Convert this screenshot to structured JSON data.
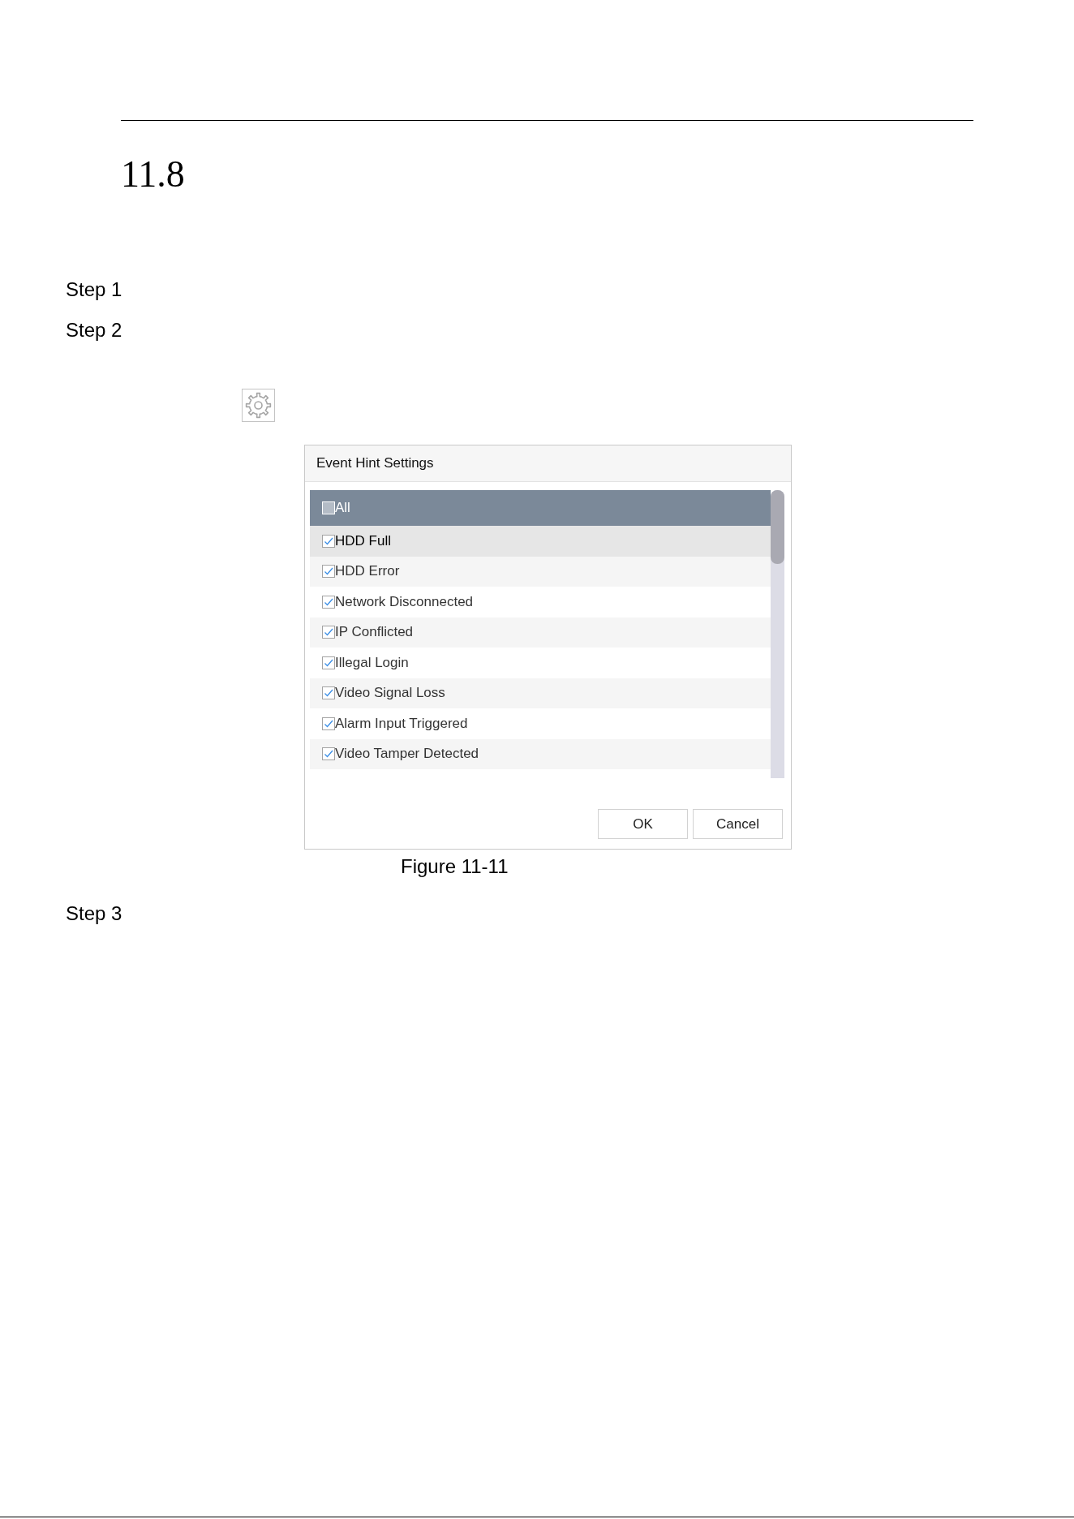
{
  "section_number": "11.8",
  "steps_before": [
    {
      "label": "Step 1"
    },
    {
      "label": "Step 2"
    }
  ],
  "dialog": {
    "title": "Event Hint Settings",
    "select_all": {
      "label": "All",
      "checked": false
    },
    "items": [
      {
        "label": "HDD Full",
        "checked": true,
        "selected": true
      },
      {
        "label": "HDD Error",
        "checked": true,
        "selected": false
      },
      {
        "label": "Network Disconnected",
        "checked": true,
        "selected": false
      },
      {
        "label": "IP Conflicted",
        "checked": true,
        "selected": false
      },
      {
        "label": "Illegal Login",
        "checked": true,
        "selected": false
      },
      {
        "label": "Video Signal Loss",
        "checked": true,
        "selected": false
      },
      {
        "label": "Alarm Input Triggered",
        "checked": true,
        "selected": false
      },
      {
        "label": "Video Tamper Detected",
        "checked": true,
        "selected": false
      }
    ],
    "buttons": [
      {
        "label": "OK"
      },
      {
        "label": "Cancel"
      }
    ]
  },
  "figure_caption": "Figure 11-11",
  "steps_after": [
    {
      "label": "Step 3"
    }
  ]
}
